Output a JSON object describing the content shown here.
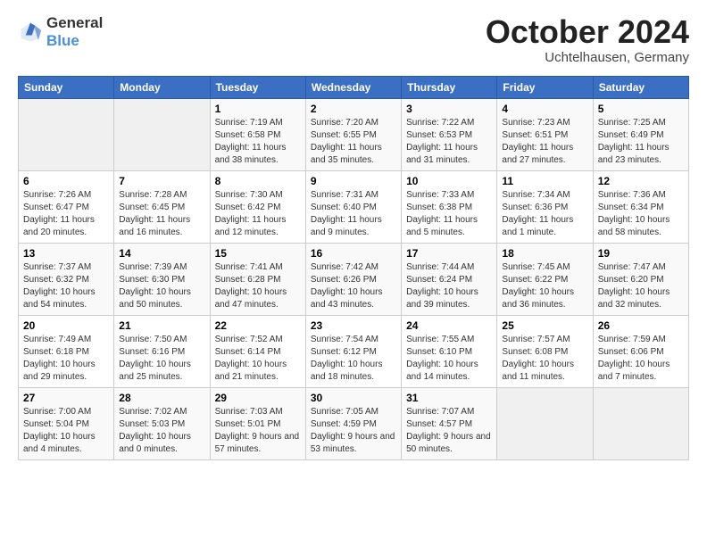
{
  "logo": {
    "general": "General",
    "blue": "Blue"
  },
  "header": {
    "month": "October 2024",
    "location": "Uchtelhausen, Germany"
  },
  "weekdays": [
    "Sunday",
    "Monday",
    "Tuesday",
    "Wednesday",
    "Thursday",
    "Friday",
    "Saturday"
  ],
  "weeks": [
    [
      {
        "day": "",
        "sunrise": "",
        "sunset": "",
        "daylight": ""
      },
      {
        "day": "",
        "sunrise": "",
        "sunset": "",
        "daylight": ""
      },
      {
        "day": "1",
        "sunrise": "Sunrise: 7:19 AM",
        "sunset": "Sunset: 6:58 PM",
        "daylight": "Daylight: 11 hours and 38 minutes."
      },
      {
        "day": "2",
        "sunrise": "Sunrise: 7:20 AM",
        "sunset": "Sunset: 6:55 PM",
        "daylight": "Daylight: 11 hours and 35 minutes."
      },
      {
        "day": "3",
        "sunrise": "Sunrise: 7:22 AM",
        "sunset": "Sunset: 6:53 PM",
        "daylight": "Daylight: 11 hours and 31 minutes."
      },
      {
        "day": "4",
        "sunrise": "Sunrise: 7:23 AM",
        "sunset": "Sunset: 6:51 PM",
        "daylight": "Daylight: 11 hours and 27 minutes."
      },
      {
        "day": "5",
        "sunrise": "Sunrise: 7:25 AM",
        "sunset": "Sunset: 6:49 PM",
        "daylight": "Daylight: 11 hours and 23 minutes."
      }
    ],
    [
      {
        "day": "6",
        "sunrise": "Sunrise: 7:26 AM",
        "sunset": "Sunset: 6:47 PM",
        "daylight": "Daylight: 11 hours and 20 minutes."
      },
      {
        "day": "7",
        "sunrise": "Sunrise: 7:28 AM",
        "sunset": "Sunset: 6:45 PM",
        "daylight": "Daylight: 11 hours and 16 minutes."
      },
      {
        "day": "8",
        "sunrise": "Sunrise: 7:30 AM",
        "sunset": "Sunset: 6:42 PM",
        "daylight": "Daylight: 11 hours and 12 minutes."
      },
      {
        "day": "9",
        "sunrise": "Sunrise: 7:31 AM",
        "sunset": "Sunset: 6:40 PM",
        "daylight": "Daylight: 11 hours and 9 minutes."
      },
      {
        "day": "10",
        "sunrise": "Sunrise: 7:33 AM",
        "sunset": "Sunset: 6:38 PM",
        "daylight": "Daylight: 11 hours and 5 minutes."
      },
      {
        "day": "11",
        "sunrise": "Sunrise: 7:34 AM",
        "sunset": "Sunset: 6:36 PM",
        "daylight": "Daylight: 11 hours and 1 minute."
      },
      {
        "day": "12",
        "sunrise": "Sunrise: 7:36 AM",
        "sunset": "Sunset: 6:34 PM",
        "daylight": "Daylight: 10 hours and 58 minutes."
      }
    ],
    [
      {
        "day": "13",
        "sunrise": "Sunrise: 7:37 AM",
        "sunset": "Sunset: 6:32 PM",
        "daylight": "Daylight: 10 hours and 54 minutes."
      },
      {
        "day": "14",
        "sunrise": "Sunrise: 7:39 AM",
        "sunset": "Sunset: 6:30 PM",
        "daylight": "Daylight: 10 hours and 50 minutes."
      },
      {
        "day": "15",
        "sunrise": "Sunrise: 7:41 AM",
        "sunset": "Sunset: 6:28 PM",
        "daylight": "Daylight: 10 hours and 47 minutes."
      },
      {
        "day": "16",
        "sunrise": "Sunrise: 7:42 AM",
        "sunset": "Sunset: 6:26 PM",
        "daylight": "Daylight: 10 hours and 43 minutes."
      },
      {
        "day": "17",
        "sunrise": "Sunrise: 7:44 AM",
        "sunset": "Sunset: 6:24 PM",
        "daylight": "Daylight: 10 hours and 39 minutes."
      },
      {
        "day": "18",
        "sunrise": "Sunrise: 7:45 AM",
        "sunset": "Sunset: 6:22 PM",
        "daylight": "Daylight: 10 hours and 36 minutes."
      },
      {
        "day": "19",
        "sunrise": "Sunrise: 7:47 AM",
        "sunset": "Sunset: 6:20 PM",
        "daylight": "Daylight: 10 hours and 32 minutes."
      }
    ],
    [
      {
        "day": "20",
        "sunrise": "Sunrise: 7:49 AM",
        "sunset": "Sunset: 6:18 PM",
        "daylight": "Daylight: 10 hours and 29 minutes."
      },
      {
        "day": "21",
        "sunrise": "Sunrise: 7:50 AM",
        "sunset": "Sunset: 6:16 PM",
        "daylight": "Daylight: 10 hours and 25 minutes."
      },
      {
        "day": "22",
        "sunrise": "Sunrise: 7:52 AM",
        "sunset": "Sunset: 6:14 PM",
        "daylight": "Daylight: 10 hours and 21 minutes."
      },
      {
        "day": "23",
        "sunrise": "Sunrise: 7:54 AM",
        "sunset": "Sunset: 6:12 PM",
        "daylight": "Daylight: 10 hours and 18 minutes."
      },
      {
        "day": "24",
        "sunrise": "Sunrise: 7:55 AM",
        "sunset": "Sunset: 6:10 PM",
        "daylight": "Daylight: 10 hours and 14 minutes."
      },
      {
        "day": "25",
        "sunrise": "Sunrise: 7:57 AM",
        "sunset": "Sunset: 6:08 PM",
        "daylight": "Daylight: 10 hours and 11 minutes."
      },
      {
        "day": "26",
        "sunrise": "Sunrise: 7:59 AM",
        "sunset": "Sunset: 6:06 PM",
        "daylight": "Daylight: 10 hours and 7 minutes."
      }
    ],
    [
      {
        "day": "27",
        "sunrise": "Sunrise: 7:00 AM",
        "sunset": "Sunset: 5:04 PM",
        "daylight": "Daylight: 10 hours and 4 minutes."
      },
      {
        "day": "28",
        "sunrise": "Sunrise: 7:02 AM",
        "sunset": "Sunset: 5:03 PM",
        "daylight": "Daylight: 10 hours and 0 minutes."
      },
      {
        "day": "29",
        "sunrise": "Sunrise: 7:03 AM",
        "sunset": "Sunset: 5:01 PM",
        "daylight": "Daylight: 9 hours and 57 minutes."
      },
      {
        "day": "30",
        "sunrise": "Sunrise: 7:05 AM",
        "sunset": "Sunset: 4:59 PM",
        "daylight": "Daylight: 9 hours and 53 minutes."
      },
      {
        "day": "31",
        "sunrise": "Sunrise: 7:07 AM",
        "sunset": "Sunset: 4:57 PM",
        "daylight": "Daylight: 9 hours and 50 minutes."
      },
      {
        "day": "",
        "sunrise": "",
        "sunset": "",
        "daylight": ""
      },
      {
        "day": "",
        "sunrise": "",
        "sunset": "",
        "daylight": ""
      }
    ]
  ]
}
